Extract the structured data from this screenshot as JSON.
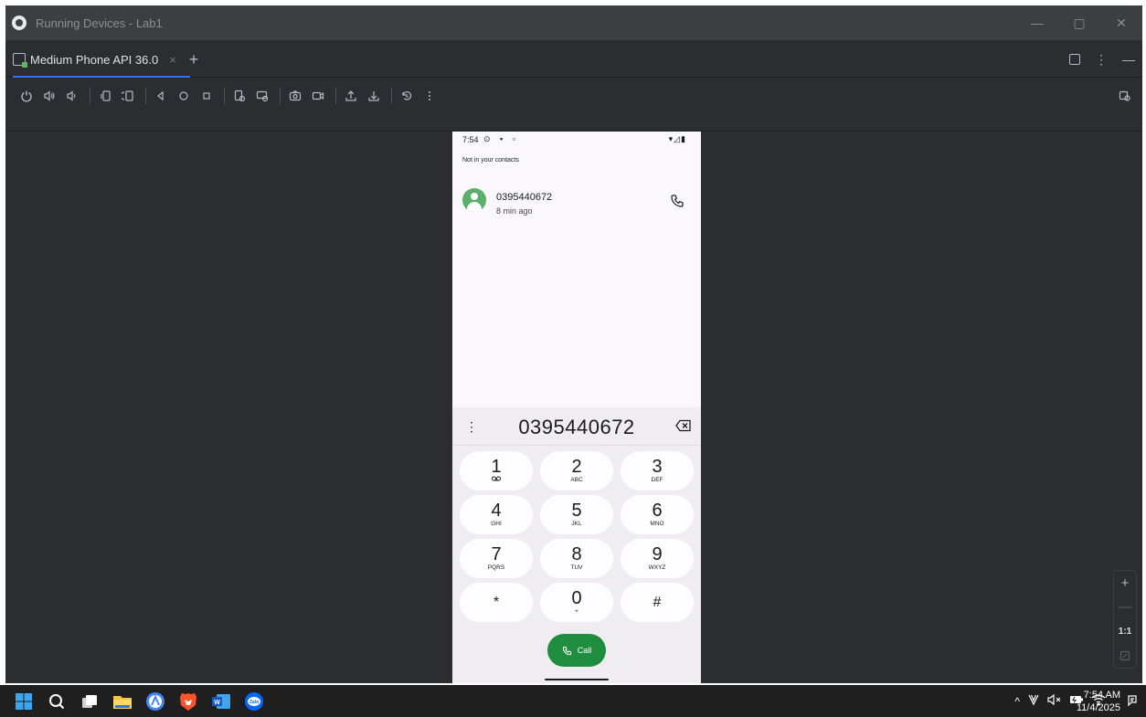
{
  "window": {
    "title": "Running Devices - Lab1",
    "controls": {
      "minimize": "—",
      "restore": "▢",
      "close": "✕"
    }
  },
  "tab": {
    "label": "Medium Phone API 36.0",
    "close": "×",
    "add": "+",
    "more": "⋮",
    "hide": "—"
  },
  "toolbar": {
    "icons": [
      "power-icon",
      "volume-up-icon",
      "volume-down-icon",
      "rotate-left-icon",
      "rotate-right-icon",
      "back-icon",
      "home-icon",
      "overview-icon",
      "snapshot-icon",
      "snapshot-settings-icon",
      "screenshot-icon",
      "screen-record-icon",
      "upload-icon",
      "download-icon",
      "reset-icon",
      "more-icon"
    ]
  },
  "phone": {
    "status_time": "7:54",
    "section_header": "Not in your contacts",
    "recent_call": {
      "number": "0395440672",
      "time": "8 min ago"
    },
    "dialed_digits": "0395440672",
    "keys": [
      {
        "digit": "1",
        "letters": ""
      },
      {
        "digit": "2",
        "letters": "ABC"
      },
      {
        "digit": "3",
        "letters": "DEF"
      },
      {
        "digit": "4",
        "letters": "GHI"
      },
      {
        "digit": "5",
        "letters": "JKL"
      },
      {
        "digit": "6",
        "letters": "MNO"
      },
      {
        "digit": "7",
        "letters": "PQRS"
      },
      {
        "digit": "8",
        "letters": "TUV"
      },
      {
        "digit": "9",
        "letters": "WXYZ"
      },
      {
        "digit": "*",
        "letters": ""
      },
      {
        "digit": "0",
        "letters": "+"
      },
      {
        "digit": "#",
        "letters": ""
      }
    ],
    "call_label": "Call"
  },
  "zoom": {
    "in": "+",
    "out": "—",
    "actual": "1:1"
  },
  "taskbar": {
    "time": "7:54 AM",
    "date": "11/4/2025",
    "chevron": "^"
  },
  "colors": {
    "ide_bg": "#2b2d30",
    "accent": "#3574f0",
    "call_green": "#1e8e3e",
    "avatar_green": "#5ab06a"
  }
}
